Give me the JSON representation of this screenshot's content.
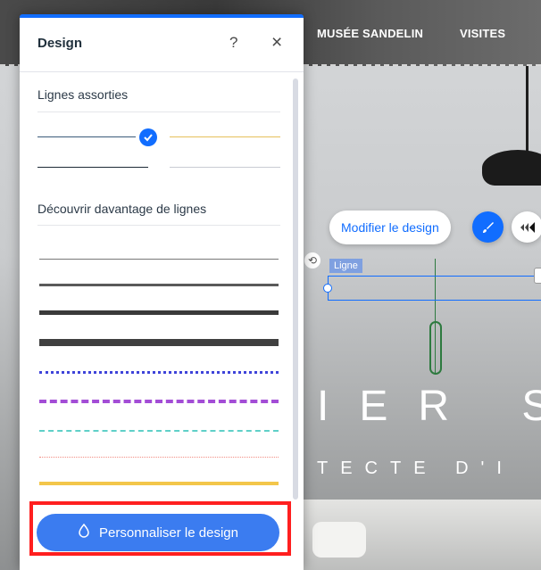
{
  "site": {
    "nav": [
      "MUSÉE SANDELIN",
      "VISITES"
    ],
    "toolbar": {
      "modifier_label": "Modifier le design",
      "edit_icon": "paint-brush-icon",
      "animate_icon": "animation-icon"
    },
    "selection_tag": "Ligne",
    "hero_text": "IER S",
    "hero_sub": "TECTE D'I"
  },
  "panel": {
    "title": "Design",
    "help_label": "?",
    "close_label": "×",
    "matching_lines_title": "Lignes assorties",
    "more_lines_title": "Découvrir davantage de lignes",
    "customize_label": "Personnaliser le design",
    "customize_icon": "droplet-icon"
  },
  "colors": {
    "accent": "#116dff",
    "highlight": "#ff1f1f",
    "gold": "#f3c64a",
    "purple": "#a34dd6",
    "teal": "#5fd0c8",
    "coral": "#f28b82",
    "blue_dots": "#3f44d9"
  }
}
